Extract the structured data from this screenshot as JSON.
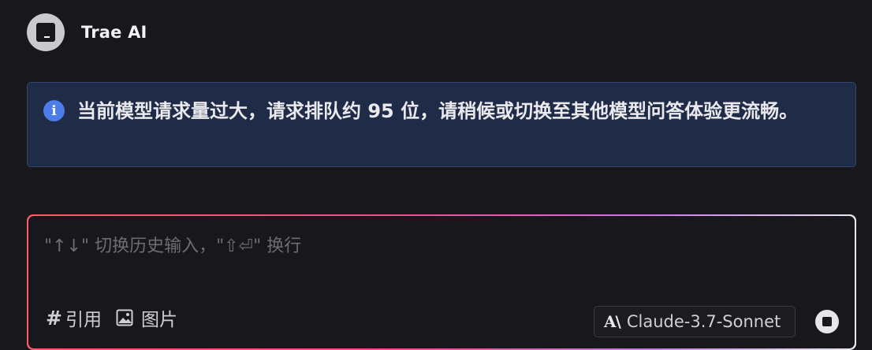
{
  "header": {
    "avatar_icon": "terminal-square-icon",
    "title": "Trae AI"
  },
  "notice": {
    "icon": "info-icon",
    "icon_glyph": "i",
    "message": "当前模型请求量过大，请求排队约 95 位，请稍候或切换至其他模型问答体验更流畅。"
  },
  "composer": {
    "input_value": "",
    "placeholder": "\"↑↓\" 切换历史输入，\"⇧⏎\" 换行",
    "hash_glyph": "#",
    "reference_label": "引用",
    "image_label": "图片",
    "model_logo": "A\\",
    "model_name": "Claude-3.7-Sonnet"
  },
  "colors": {
    "background": "#18181c",
    "notice_bg": "#1f2b47",
    "notice_border": "#34466f",
    "info_blue": "#4c7de8",
    "gradient_start": "#ff5c6a",
    "gradient_mid": "#ef4d8e",
    "gradient_end": "#e9e9f0"
  }
}
